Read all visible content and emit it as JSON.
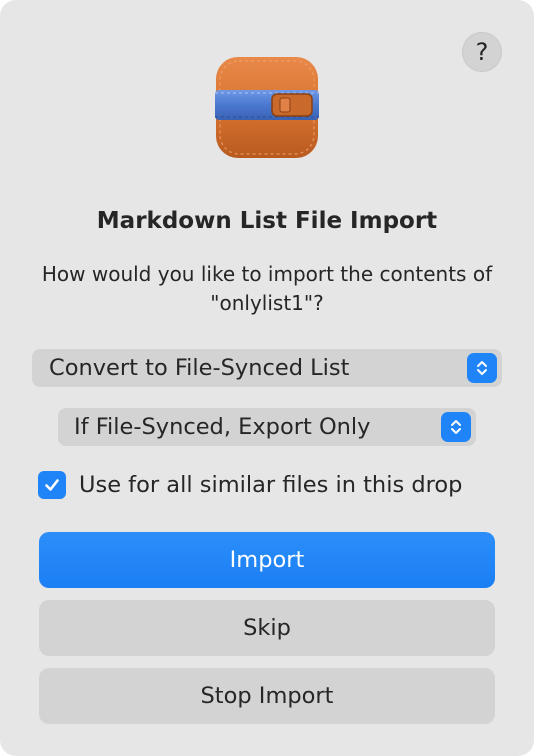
{
  "dialog": {
    "help_label": "?",
    "app_icon": "archive-box-icon",
    "title": "Markdown List File Import",
    "message": "How would you like to import the contents of \"onlylist1\"?",
    "popup_primary": {
      "value": "Convert to File-Synced List"
    },
    "popup_secondary": {
      "value": "If File-Synced, Export Only"
    },
    "checkbox": {
      "label": "Use for all similar files in this drop",
      "checked": true
    },
    "buttons": {
      "import": "Import",
      "skip": "Skip",
      "stop": "Stop Import"
    },
    "colors": {
      "accent": "#1f84f7",
      "dialog_bg": "#e6e6e6",
      "control_bg": "#d3d3d3",
      "icon_leather": "#d9742f",
      "icon_strap": "#4a78cf"
    }
  }
}
